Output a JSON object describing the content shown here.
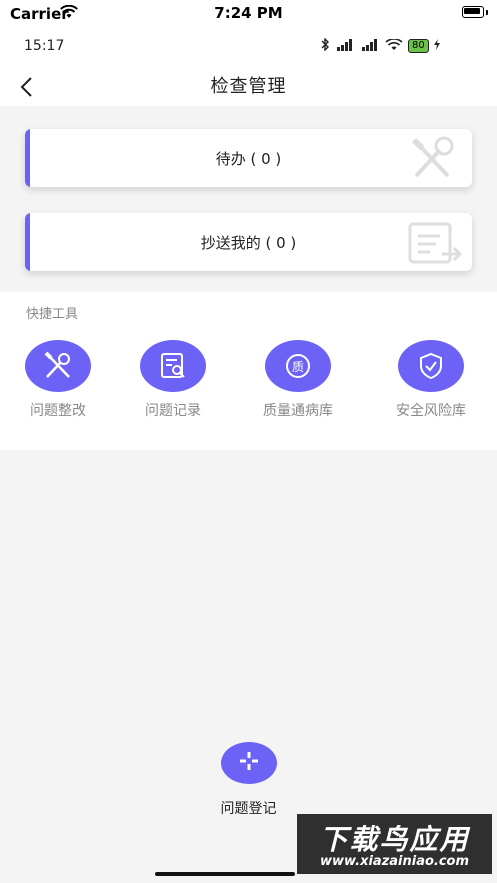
{
  "ios_status": {
    "carrier": "Carrier",
    "time": "7:24 PM"
  },
  "android_status": {
    "time": "15:17",
    "battery": "80"
  },
  "navbar": {
    "title": "检查管理"
  },
  "cards": [
    {
      "label": "待办 ( 0 )",
      "icon": "wrench-screwdriver-icon"
    },
    {
      "label": "抄送我的 ( 0 )",
      "icon": "document-arrow-icon"
    }
  ],
  "tools": {
    "section_title": "快捷工具",
    "items": [
      {
        "label": "问题整改",
        "icon": "wrench-screwdriver-icon"
      },
      {
        "label": "问题记录",
        "icon": "document-search-icon"
      },
      {
        "label": "质量通病库",
        "icon": "quality-badge-icon",
        "glyph": "质"
      },
      {
        "label": "安全风险库",
        "icon": "shield-check-icon"
      }
    ]
  },
  "fab": {
    "label": "问题登记",
    "icon": "plus-icon"
  },
  "watermark": {
    "top": "下载鸟应用",
    "bottom": "www.xiazainiao.com"
  },
  "colors": {
    "accent": "#6c63f6",
    "background": "#f4f4f4"
  }
}
